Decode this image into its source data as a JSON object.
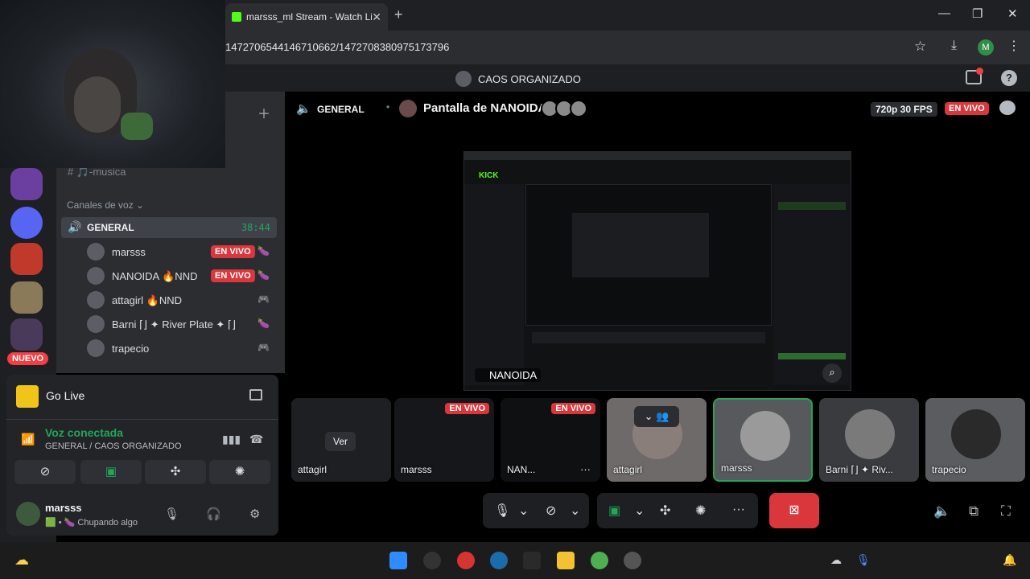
{
  "browser": {
    "tab_title": "marsss_ml Stream - Watch Live",
    "tab_close": "✕",
    "new_tab": "+",
    "url": "1472706544146710662/1472708380975173796",
    "profile_initial": "M",
    "window_controls": [
      "—",
      "❐",
      "✕"
    ]
  },
  "discord": {
    "server_name": "CAOS ORGANIZADO",
    "channels": {
      "text_channel": "# 🎵-musica",
      "voice_category": "Canales de voz ⌄",
      "voice_channel": {
        "name": "GENERAL",
        "time": "38:44"
      },
      "members": [
        {
          "name": "marsss",
          "badge": "EN VIVO",
          "icon": "🍆"
        },
        {
          "name": "NANOIDA 🔥NND",
          "badge": "EN VIVO",
          "icon": "🍆"
        },
        {
          "name": "attagirl 🔥NND",
          "badge": "",
          "icon": "🎮"
        },
        {
          "name": "Barni ⌈⌋ ✦ River Plate ✦ ⌈⌋",
          "badge": "",
          "icon": "🍆"
        },
        {
          "name": "trapecio",
          "badge": "",
          "icon": "🎮"
        }
      ],
      "new_badge": "NUEVO"
    },
    "go_live": {
      "label": "Go Live"
    },
    "voice_connected": {
      "title": "Voz conectada",
      "subtitle": "GENERAL / CAOS ORGANIZADO"
    },
    "user": {
      "name": "marsss",
      "status": "🟩 • 🍆 Chupando algo"
    },
    "stream": {
      "channel": "GENERAL",
      "title": "Pantalla de NANOIDA",
      "quality": "720p 30 FPS",
      "live_label": "EN VIVO",
      "presenter_label": "NANOIDA",
      "tiles": [
        {
          "label": "attagirl",
          "type": "watch",
          "button": "Ver"
        },
        {
          "label": "marsss",
          "type": "stream",
          "live": "EN VIVO"
        },
        {
          "label": "NAN...",
          "type": "stream",
          "live": "EN VIVO"
        },
        {
          "label": "attagirl",
          "type": "camera"
        },
        {
          "label": "marsss",
          "type": "camera",
          "selected": true
        },
        {
          "label": "Barni ⌈⌋ ✦ Riv...",
          "type": "camera"
        },
        {
          "label": "trapecio",
          "type": "camera"
        }
      ]
    }
  },
  "colors": {
    "accent_green": "#23a55a",
    "live_red": "#da373c",
    "kick_green": "#53fc18"
  }
}
